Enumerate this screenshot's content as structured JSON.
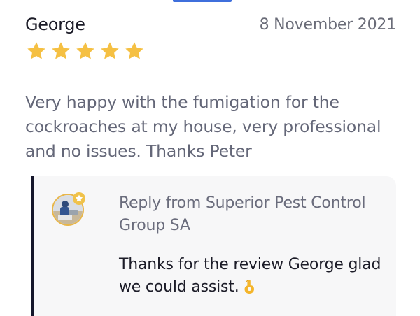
{
  "review": {
    "author": "George",
    "date": "8 November 2021",
    "rating": 5,
    "rating_max": 5,
    "text": "Very happy with the fumigation for the cockroaches at my house, very professional and no issues. Thanks Peter"
  },
  "reply": {
    "header": "Reply from Superior Pest Control Group SA",
    "text": "Thanks for the review George glad we could assist.",
    "emoji_icon": "ok-hand-emoji-icon",
    "avatar_icon": "business-avatar-icon"
  },
  "colors": {
    "star": "#f5c043",
    "accent": "#3f6fdc",
    "reply_bar": "#15162b",
    "reply_bg": "#f7f7f8",
    "body_text": "#646778",
    "name_text": "#1c1c28"
  }
}
